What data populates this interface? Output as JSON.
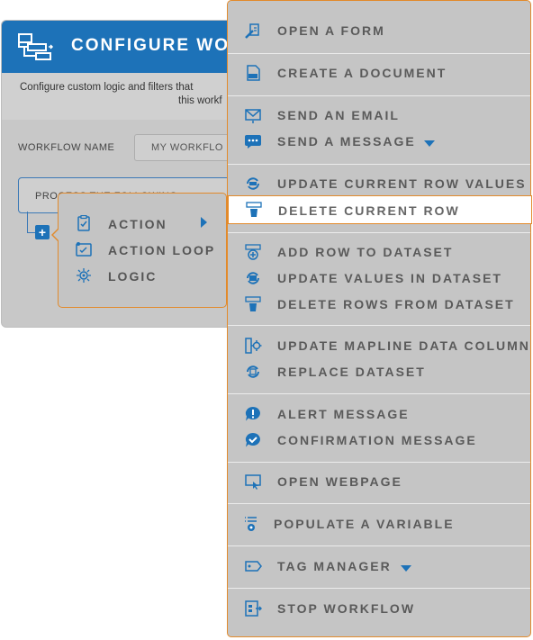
{
  "dialog": {
    "title": "CONFIGURE WO",
    "desc_line1": "Configure custom logic and filters that",
    "desc_line2": "this workf",
    "workflow_name_label": "WORKFLOW NAME",
    "workflow_name_value": "MY WORKFLO",
    "process_text": "PROCESS THE FOLLOWING",
    "add_symbol": "+"
  },
  "small_menu": {
    "items": [
      {
        "label": "ACTION",
        "icon": "clipboard-check-icon"
      },
      {
        "label": "ACTION LOOP",
        "icon": "loop-check-icon"
      },
      {
        "label": "LOGIC",
        "icon": "logic-gear-icon"
      }
    ]
  },
  "menu": {
    "items": [
      {
        "label": "OPEN A FORM",
        "icon": "form-pen-icon"
      },
      {
        "label": "CREATE A DOCUMENT",
        "icon": "pdf-document-icon"
      },
      {
        "label": "SEND AN EMAIL",
        "icon": "envelope-icon"
      },
      {
        "label": "SEND A MESSAGE",
        "icon": "chat-bubble-icon"
      },
      {
        "label": "UPDATE CURRENT ROW VALUES",
        "icon": "row-refresh-icon"
      },
      {
        "label": "DELETE CURRENT ROW",
        "icon": "row-delete-icon"
      },
      {
        "label": "ADD ROW TO DATASET",
        "icon": "row-add-icon"
      },
      {
        "label": "UPDATE VALUES IN DATASET",
        "icon": "dataset-refresh-icon"
      },
      {
        "label": "DELETE ROWS FROM DATASET",
        "icon": "rows-delete-icon"
      },
      {
        "label": "UPDATE MAPLINE DATA COLUMN",
        "icon": "column-gear-icon"
      },
      {
        "label": "REPLACE DATASET",
        "icon": "dataset-replace-icon"
      },
      {
        "label": "ALERT MESSAGE",
        "icon": "alert-bubble-icon"
      },
      {
        "label": "CONFIRMATION MESSAGE",
        "icon": "check-bubble-icon"
      },
      {
        "label": "OPEN WEBPAGE",
        "icon": "monitor-cursor-icon"
      },
      {
        "label": "POPULATE A VARIABLE",
        "icon": "variable-list-icon"
      },
      {
        "label": "TAG MANAGER",
        "icon": "tag-icon"
      },
      {
        "label": "STOP WORKFLOW",
        "icon": "stop-workflow-icon"
      }
    ]
  },
  "colors": {
    "accent": "#1d72b8",
    "highlight_border": "#e28a2b"
  }
}
